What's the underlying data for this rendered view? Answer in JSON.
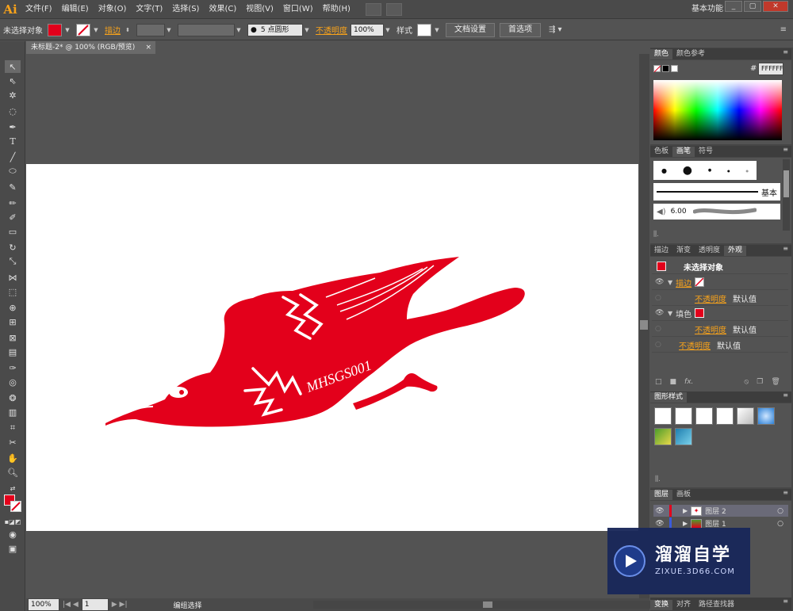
{
  "app": {
    "logo": "Ai"
  },
  "menu": [
    "文件(F)",
    "编辑(E)",
    "对象(O)",
    "文字(T)",
    "选择(S)",
    "效果(C)",
    "视图(V)",
    "窗口(W)",
    "帮助(H)"
  ],
  "workspace": "基本功能",
  "window_buttons": [
    "_",
    "▢",
    "✕"
  ],
  "controlbar": {
    "selection_status": "未选择对象",
    "stroke_label": "描边",
    "brush_label": "5 点圆形",
    "opacity_label": "不透明度",
    "opacity_value": "100%",
    "style_label": "样式",
    "doc_setup_button": "文档设置",
    "preferences_button": "首选项"
  },
  "document": {
    "tab_title": "未标题-2* @ 100% (RGB/预览)",
    "close": "×"
  },
  "artwork": {
    "text": "MHSGS001",
    "color": "#e3001b"
  },
  "statusbar": {
    "zoom": "100%",
    "page": "1",
    "tool_status": "编组选择"
  },
  "panels": {
    "color": {
      "tabs": [
        "颜色",
        "颜色参考"
      ],
      "hex_label": "#",
      "hex_value": "FFFFFF"
    },
    "brushes": {
      "tabs": [
        "色板",
        "画笔",
        "符号"
      ],
      "basic_label": "基本",
      "size_value": "6.00"
    },
    "appearance": {
      "tabs": [
        "描边",
        "渐变",
        "透明度",
        "外观"
      ],
      "title": "未选择对象",
      "rows": [
        {
          "label": "描边",
          "value": ""
        },
        {
          "label": "不透明度",
          "value": "默认值"
        },
        {
          "label": "填色",
          "value": ""
        },
        {
          "label": "不透明度",
          "value": "默认值"
        },
        {
          "label": "不透明度",
          "value": "默认值"
        }
      ],
      "fx": "fx."
    },
    "graphic_styles": {
      "tabs": [
        "图形样式"
      ]
    },
    "layers": {
      "tabs": [
        "图层",
        "画板"
      ],
      "items": [
        {
          "name": "图层 2",
          "color": "#e3001b"
        },
        {
          "name": "图层 1",
          "color": "#3b5bdb"
        }
      ]
    },
    "bottom_tabs": [
      "变换",
      "对齐",
      "路径查找器"
    ]
  },
  "watermark": {
    "title": "溜溜自学",
    "url": "ZIXUE.3D66.COM"
  }
}
